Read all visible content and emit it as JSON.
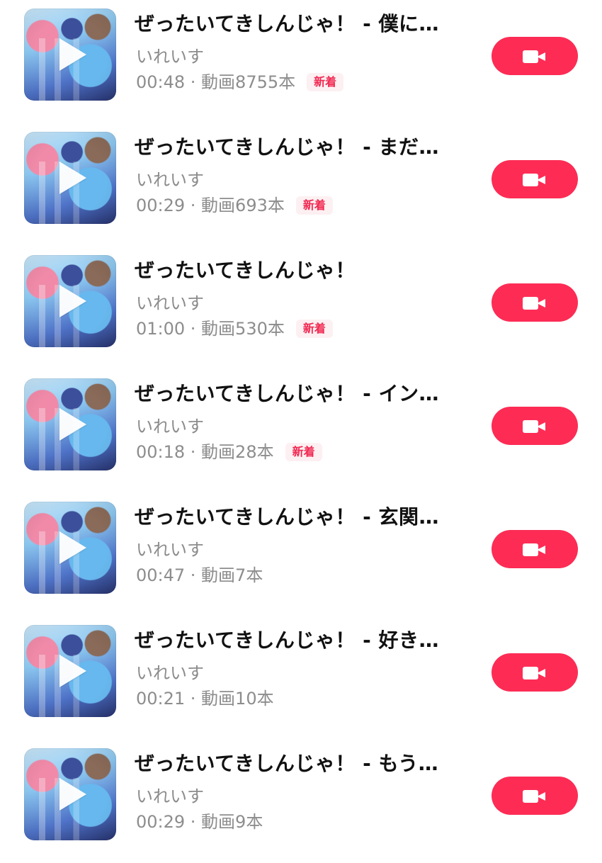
{
  "tracks": [
    {
      "title": "ぜったいてきしんじゃ！ - 僕に…",
      "artist": "いれいす",
      "meta": "00:48 · 動画8755本",
      "badge": "新着"
    },
    {
      "title": "ぜったいてきしんじゃ！ - まだ…",
      "artist": "いれいす",
      "meta": "00:29 · 動画693本",
      "badge": "新着"
    },
    {
      "title": "ぜったいてきしんじゃ！",
      "artist": "いれいす",
      "meta": "01:00 · 動画530本",
      "badge": "新着"
    },
    {
      "title": "ぜったいてきしんじゃ！ - イン…",
      "artist": "いれいす",
      "meta": "00:18 · 動画28本",
      "badge": "新着"
    },
    {
      "title": "ぜったいてきしんじゃ！ - 玄関…",
      "artist": "いれいす",
      "meta": "00:47 · 動画7本",
      "badge": ""
    },
    {
      "title": "ぜったいてきしんじゃ！ - 好き…",
      "artist": "いれいす",
      "meta": "00:21 · 動画10本",
      "badge": ""
    },
    {
      "title": "ぜったいてきしんじゃ！ - もう…",
      "artist": "いれいす",
      "meta": "00:29 · 動画9本",
      "badge": ""
    }
  ],
  "icons": {
    "thumbnail_overlay": "play-icon",
    "action_button": "video-camera-icon"
  },
  "colors": {
    "accent": "#fe2c55",
    "badge_text": "#f12952",
    "badge_background": "#fdf0f2",
    "title_text": "#111111",
    "secondary_text": "#8c8c8c"
  }
}
